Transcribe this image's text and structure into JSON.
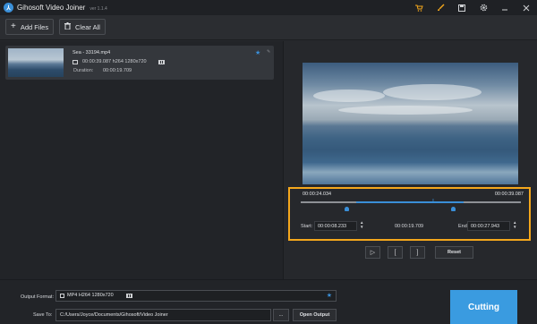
{
  "app": {
    "title": "Gihosoft Video Joiner",
    "version": "ver 1.1.4",
    "logo_letter": "⅄"
  },
  "titlebar_icons": [
    "cart-icon",
    "brush-icon",
    "save-icon",
    "gear-icon",
    "minimize-icon",
    "close-icon"
  ],
  "toolbar": {
    "add_files_label": "Add Files",
    "clear_all_label": "Clear All"
  },
  "file": {
    "name": "Sea - 33194.mp4",
    "meta": "00:00:39.087 h264 1280x720",
    "duration_label": "Duration:",
    "duration_value": "00:00:19.709"
  },
  "trim": {
    "start_time": "00:00:24.034",
    "end_time": "00:00:39.087",
    "start_label": "Start:",
    "start_value": "00:00:08.233",
    "duration_value": "00:00:19.709",
    "end_label": "End:",
    "end_value": "00:00:27.943",
    "spin_up": "▲",
    "spin_down": "▼"
  },
  "controls": {
    "play": "▷",
    "mark_in": "[",
    "mark_out": "]",
    "reset": "Reset"
  },
  "output": {
    "format_label": "Output Format:",
    "format_value": "MP4 H264 1280x720",
    "save_label": "Save To:",
    "save_path": "C:/Users/Joyce/Documents/Gihosoft/Video Joiner",
    "browse_label": "...",
    "open_label": "Open Output",
    "cut_label": "Cutting"
  },
  "colors": {
    "accent": "#3a8fd8",
    "highlight": "#f4a71c",
    "cut_button": "#3a9be0"
  }
}
